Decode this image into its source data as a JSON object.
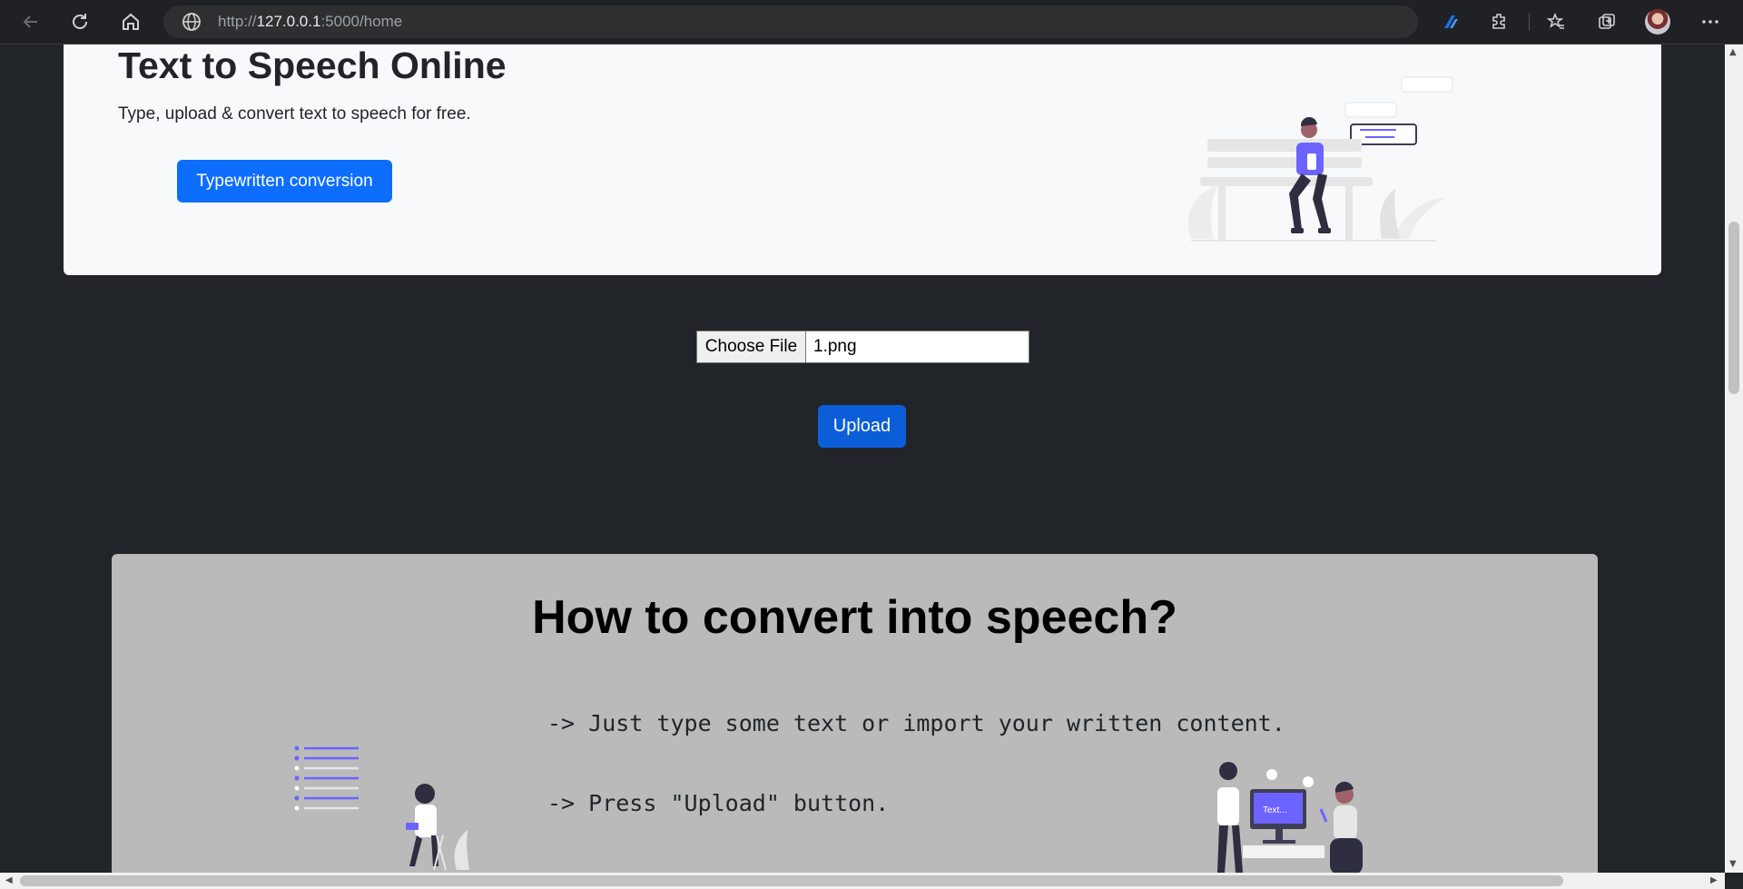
{
  "browser": {
    "url_prefix": "http://",
    "url_host": "127.0.0.1",
    "url_rest": ":5000/home",
    "icons": [
      "back-icon",
      "refresh-icon",
      "home-icon",
      "globe-icon",
      "copilot-icon",
      "extensions-icon",
      "favorites-icon",
      "collections-icon",
      "profile-avatar",
      "more-icon"
    ]
  },
  "hero": {
    "title": "Text to Speech Online",
    "subtitle": "Type, upload & convert text to speech for free.",
    "button_label": "Typewritten conversion"
  },
  "upload": {
    "choose_file_label": "Choose File",
    "file_name": "1.png",
    "upload_label": "Upload"
  },
  "howto": {
    "title": "How to convert into speech?",
    "steps": [
      "-> Just type some text or import your written content.",
      "-> Press \"Upload\" button."
    ],
    "illus_text": "Text..."
  },
  "colors": {
    "page_bg": "#212529",
    "hero_bg": "#f8f9fa",
    "primary": "#0d6efd",
    "howto_bg": "#bababa",
    "accent": "#6c63ff"
  }
}
